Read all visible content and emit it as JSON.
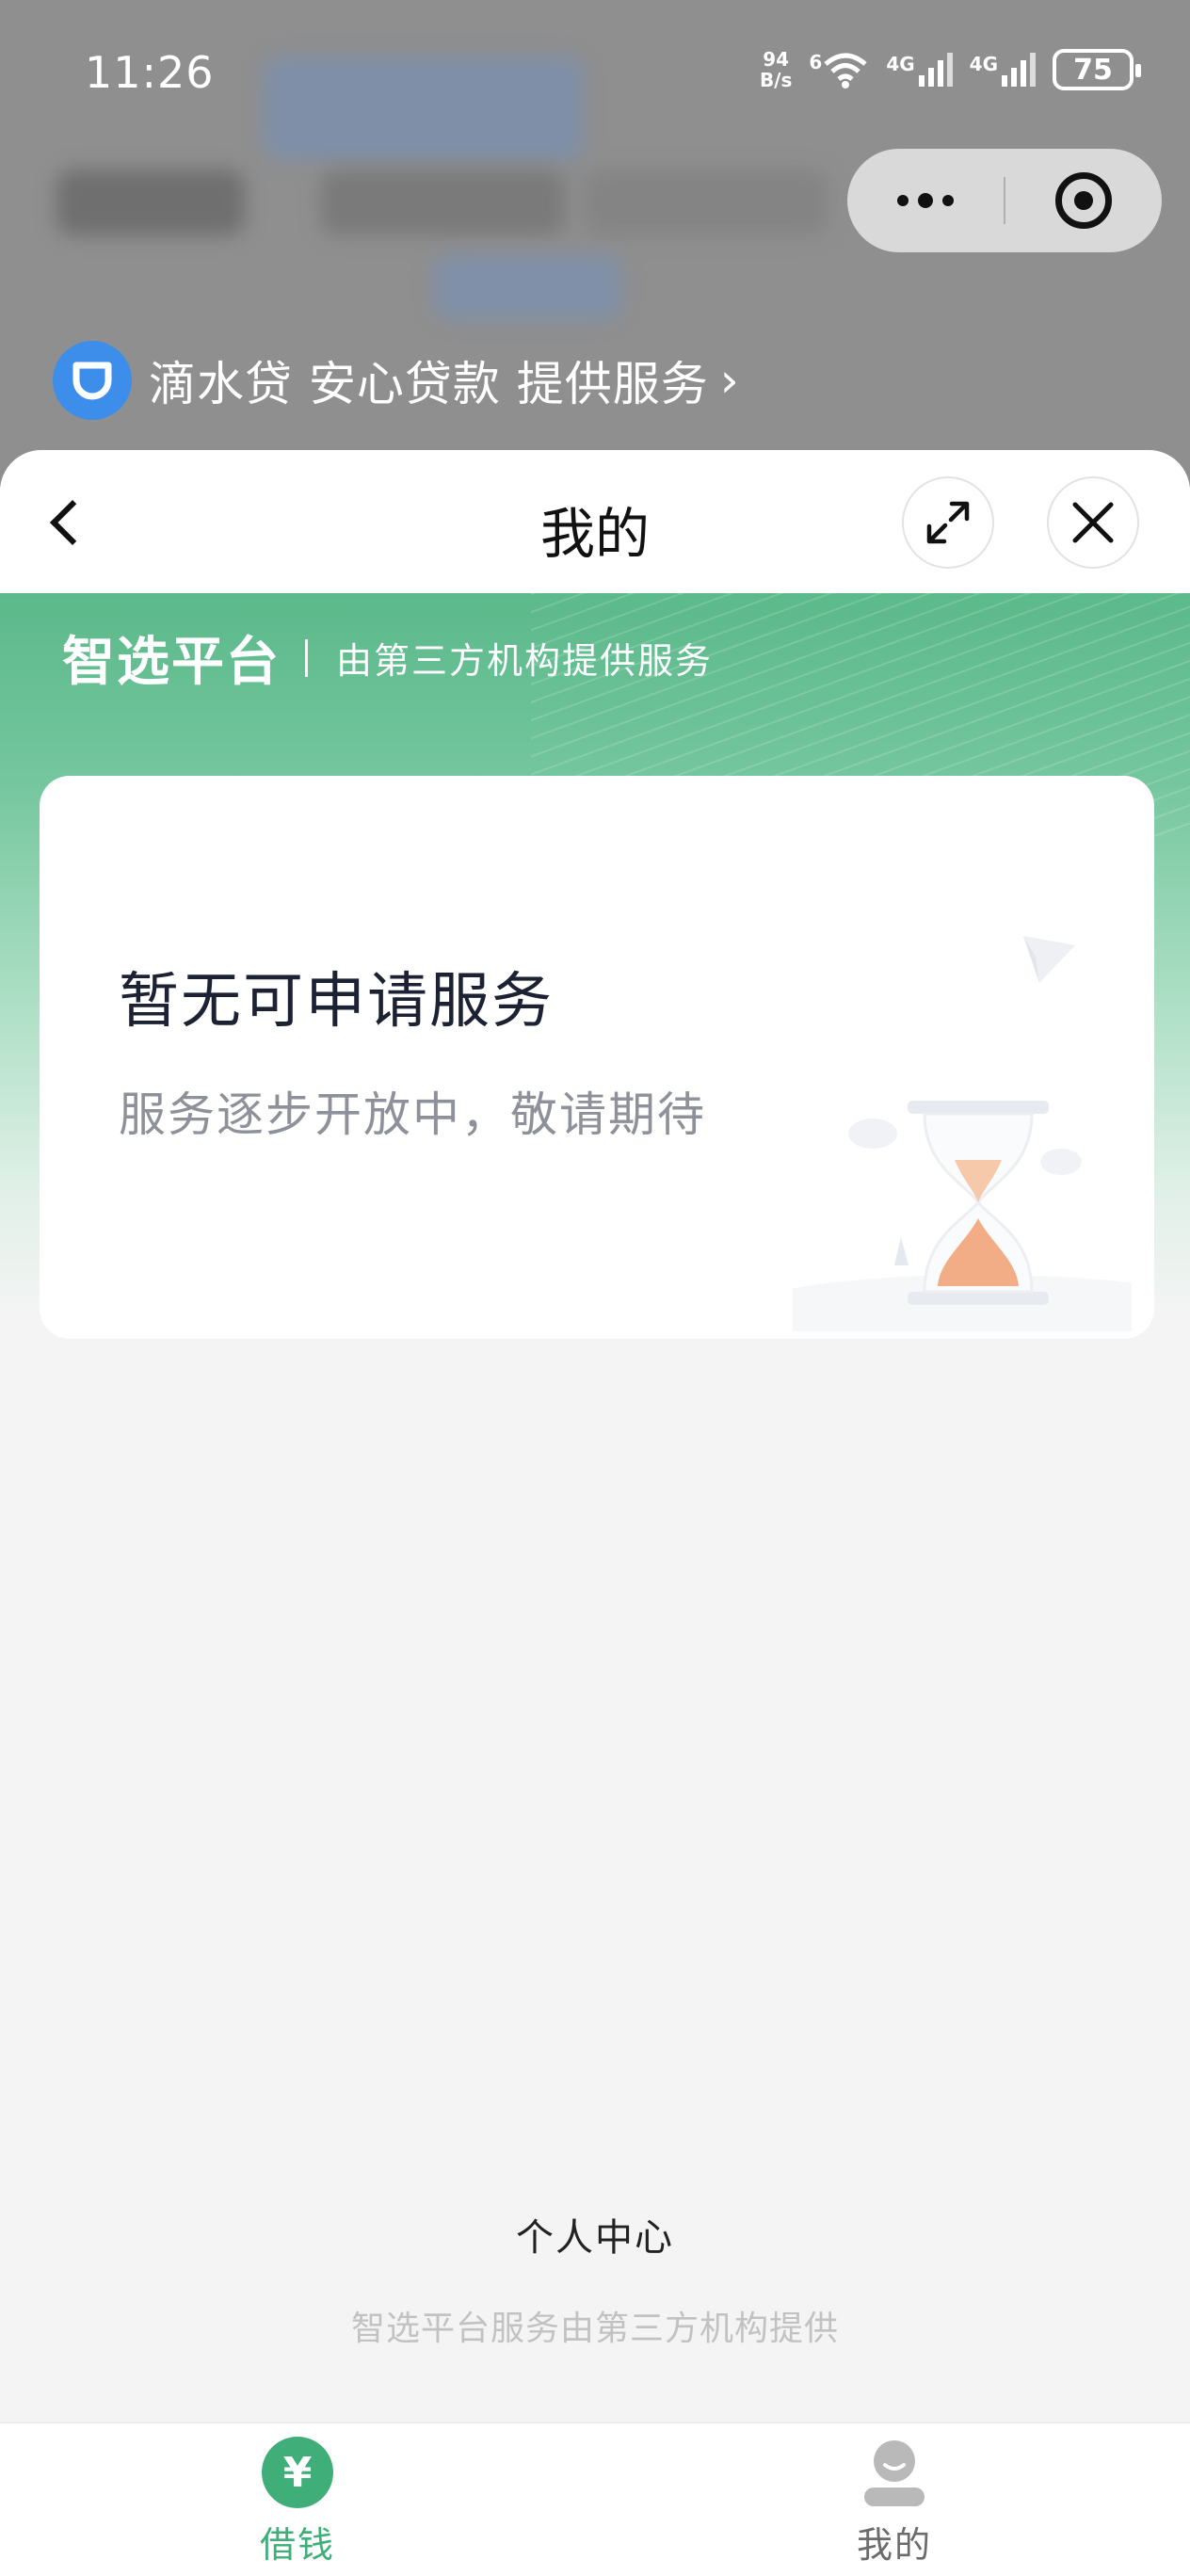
{
  "status_bar": {
    "time": "11:26",
    "net_speed_value": "94",
    "net_speed_unit": "B/s",
    "wifi_label": "6",
    "signal1_label": "4G",
    "signal2_label": "4G",
    "battery": "75"
  },
  "provider": {
    "label": "滴水贷 安心贷款 提供服务",
    "chevron": "›"
  },
  "header": {
    "title": "我的",
    "back_icon": "chevron-left-icon",
    "expand_icon": "expand-icon",
    "close_icon": "close-icon"
  },
  "hero": {
    "brand": "智选平台",
    "subtitle": "由第三方机构提供服务"
  },
  "empty_card": {
    "title": "暂无可申请服务",
    "subtitle": "服务逐步开放中，敬请期待",
    "illustration": "hourglass-illustration"
  },
  "footer": {
    "center_link": "个人中心",
    "disclaimer": "智选平台服务由第三方机构提供"
  },
  "tabbar": {
    "tabs": [
      {
        "label": "借钱",
        "icon": "yuan-icon",
        "active": true
      },
      {
        "label": "我的",
        "icon": "user-icon",
        "active": false
      }
    ]
  },
  "colors": {
    "accent_green": "#3fae78",
    "hero_green": "#5bb98a",
    "provider_blue": "#3d8eea"
  }
}
